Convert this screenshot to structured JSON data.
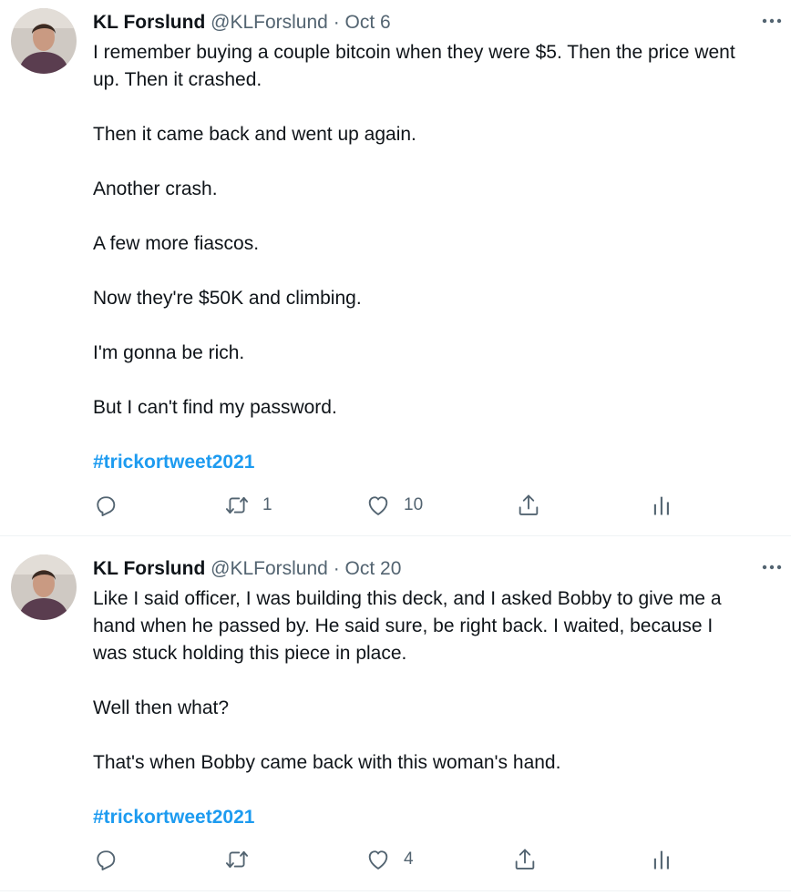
{
  "tweets": [
    {
      "name": "KL Forslund",
      "handle": "@KLForslund",
      "separator": "·",
      "date": "Oct 6",
      "lines": [
        "I remember buying a couple bitcoin when they were $5. Then the price went",
        "up.  Then it crashed.",
        "",
        "Then it came back and went up again.",
        "",
        "Another crash.",
        "",
        "A few more fiascos.",
        "",
        "Now they're $50K and climbing.",
        "",
        "I'm gonna be rich.",
        "",
        "But I can't find my password.",
        ""
      ],
      "hashtag": "#trickortweet2021",
      "retweets": "1",
      "likes": "10"
    },
    {
      "name": "KL Forslund",
      "handle": "@KLForslund",
      "separator": "·",
      "date": "Oct 20",
      "lines": [
        "Like I said officer, I was building this deck, and I asked Bobby to give me a",
        "hand when he passed by.  He said sure, be right back. I waited, because I",
        "was stuck holding this piece in place.",
        "",
        "Well then what?",
        "",
        "That's when Bobby came back with this woman's hand.",
        ""
      ],
      "hashtag": "#trickortweet2021",
      "retweets": "",
      "likes": "4"
    }
  ],
  "icons": {
    "more": "more-icon",
    "reply": "reply-icon",
    "retweet": "retweet-icon",
    "like": "heart-icon",
    "share": "share-icon",
    "analytics": "analytics-icon"
  },
  "colors": {
    "hashtag": "#1d9bf0",
    "secondary_text": "#536471",
    "primary_text": "#0f1419"
  }
}
